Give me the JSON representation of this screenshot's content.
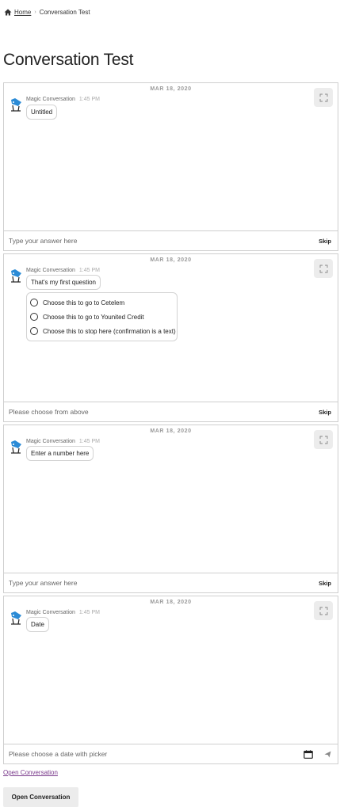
{
  "breadcrumb": {
    "home_label": "Home",
    "separator": "›",
    "current": "Conversation Test",
    "icon": "home-icon"
  },
  "page_title": "Conversation Test",
  "conversations": [
    {
      "date": "MAR 18, 2020",
      "sender": "Magic Conversation",
      "time": "1:45 PM",
      "message": "Untitled",
      "input_placeholder": "Type your answer here",
      "action_label": "Skip"
    },
    {
      "date": "MAR 18, 2020",
      "sender": "Magic Conversation",
      "time": "1:45 PM",
      "message": "That's my first question",
      "choices": [
        "Choose this to go to Cetelem",
        "Choose this to go to Younited Credit",
        "Choose this to stop here (confirmation is a text)"
      ],
      "input_placeholder": "Please choose from above",
      "action_label": "Skip"
    },
    {
      "date": "MAR 18, 2020",
      "sender": "Magic Conversation",
      "time": "1:45 PM",
      "message": "Enter a number here",
      "input_placeholder": "Type your answer here",
      "action_label": "Skip"
    },
    {
      "date": "MAR 18, 2020",
      "sender": "Magic Conversation",
      "time": "1:45 PM",
      "message": "Date",
      "input_placeholder": "Please choose a date with picker",
      "icons": [
        "calendar-icon",
        "send-icon"
      ]
    }
  ],
  "open_link_label": "Open Conversation",
  "open_button_label": "Open Conversation",
  "colors": {
    "border": "#cfcfcf",
    "expand_button_bg": "#ececec",
    "link": "#7a3a8c",
    "avatar_blue": "#2b8bd6"
  }
}
